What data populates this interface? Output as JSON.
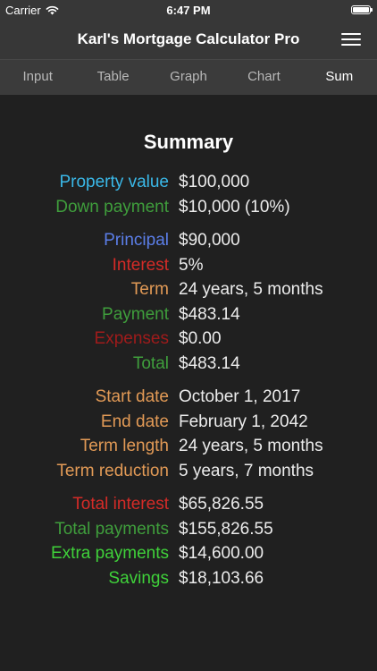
{
  "status_bar": {
    "carrier": "Carrier",
    "time": "6:47 PM"
  },
  "nav": {
    "title": "Karl's Mortgage Calculator Pro"
  },
  "tabs": [
    {
      "label": "Input"
    },
    {
      "label": "Table"
    },
    {
      "label": "Graph"
    },
    {
      "label": "Chart"
    },
    {
      "label": "Sum"
    }
  ],
  "active_tab": "Sum",
  "summary": {
    "title": "Summary",
    "groups": [
      [
        {
          "label": "Property value",
          "value": "$100,000",
          "color": "#3ab8e8"
        },
        {
          "label": "Down payment",
          "value": "$10,000 (10%)",
          "color": "#3f9e3c"
        }
      ],
      [
        {
          "label": "Principal",
          "value": "$90,000",
          "color": "#5b7ee8"
        },
        {
          "label": "Interest",
          "value": "5%",
          "color": "#d42b27"
        },
        {
          "label": "Term",
          "value": "24 years, 5 months",
          "color": "#e29a56"
        },
        {
          "label": "Payment",
          "value": "$483.14",
          "color": "#3f9e3c"
        },
        {
          "label": "Expenses",
          "value": "$0.00",
          "color": "#9f1b1b"
        },
        {
          "label": "Total",
          "value": "$483.14",
          "color": "#3f9e3c"
        }
      ],
      [
        {
          "label": "Start date",
          "value": "October 1, 2017",
          "color": "#e29a56"
        },
        {
          "label": "End date",
          "value": "February 1, 2042",
          "color": "#e29a56"
        },
        {
          "label": "Term length",
          "value": "24 years, 5 months",
          "color": "#e29a56"
        },
        {
          "label": "Term reduction",
          "value": "5 years, 7 months",
          "color": "#e29a56"
        }
      ],
      [
        {
          "label": "Total interest",
          "value": "$65,826.55",
          "color": "#d42b27"
        },
        {
          "label": "Total payments",
          "value": "$155,826.55",
          "color": "#3f9e3c"
        },
        {
          "label": "Extra payments",
          "value": "$14,600.00",
          "color": "#3fd13a"
        },
        {
          "label": "Savings",
          "value": "$18,103.66",
          "color": "#3fd13a"
        }
      ]
    ]
  }
}
